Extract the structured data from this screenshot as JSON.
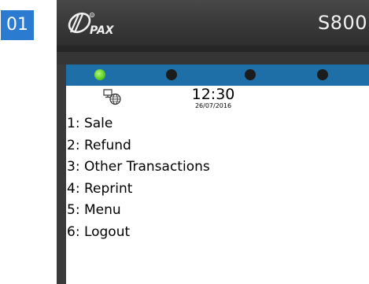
{
  "step": {
    "number": "01"
  },
  "device": {
    "brand": "PAX",
    "model": "S800",
    "leds": [
      {
        "state": "on",
        "color": "#5ed12a"
      },
      {
        "state": "off",
        "color": "#1c1c1c"
      },
      {
        "state": "off",
        "color": "#1c1c1c"
      },
      {
        "state": "off",
        "color": "#1c1c1c"
      }
    ]
  },
  "screen": {
    "status": {
      "icon": "network-connection-icon",
      "time": "12:30",
      "date": "26/07/2016"
    },
    "menu": [
      {
        "label": "1: Sale"
      },
      {
        "label": "2: Refund"
      },
      {
        "label": "3: Other Transactions"
      },
      {
        "label": "4: Reprint"
      },
      {
        "label": "5: Menu"
      },
      {
        "label": "6: Logout"
      }
    ]
  },
  "colors": {
    "step_badge": "#2b7bd0",
    "device_body": "#3a3a3a",
    "led_bar": "#1e6fa8",
    "screen_bg": "#ffffff"
  }
}
